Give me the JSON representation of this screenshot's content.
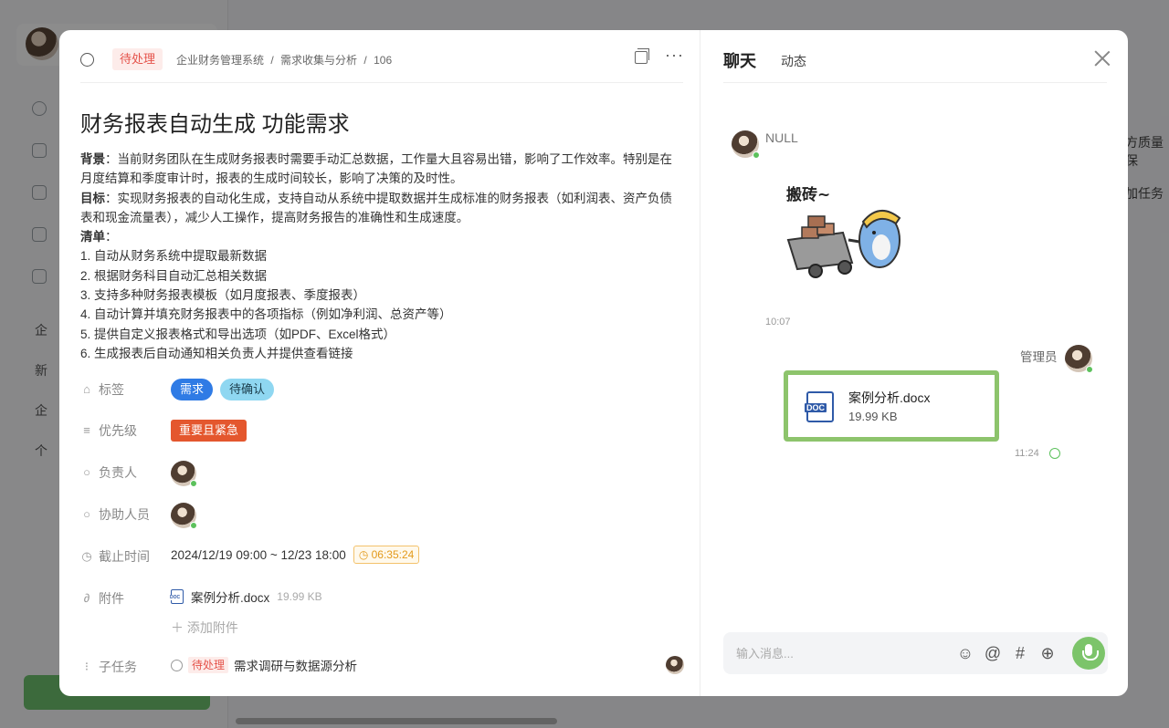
{
  "task": {
    "status": "待处理",
    "breadcrumb": [
      "企业财务管理系统",
      "/",
      "需求收集与分析",
      "/",
      "106"
    ],
    "title": "财务报表自动生成 功能需求",
    "description": {
      "background_label": "背景",
      "background": "：当前财务团队在生成财务报表时需要手动汇总数据，工作量大且容易出错，影响了工作效率。特别是在月度结算和季度审计时，报表的生成时间较长，影响了决策的及时性。",
      "goal_label": "目标",
      "goal": "：实现财务报表的自动化生成，支持自动从系统中提取数据并生成标准的财务报表（如利润表、资产负债表和现金流量表），减少人工操作，提高财务报告的准确性和生成速度。",
      "list_label": "清单",
      "list_colon": "：",
      "items": [
        "1. 自动从财务系统中提取最新数据",
        "2. 根据财务科目自动汇总相关数据",
        "3. 支持多种财务报表模板（如月度报表、季度报表）",
        "4. 自动计算并填充财务报表中的各项指标（例如净利润、总资产等）",
        "5. 提供自定义报表格式和导出选项（如PDF、Excel格式）",
        "6. 生成报表后自动通知相关负责人并提供查看链接"
      ]
    },
    "fields": {
      "tags_label": "标签",
      "tags": [
        "需求",
        "待确认"
      ],
      "priority_label": "优先级",
      "priority": "重要且紧急",
      "owner_label": "负责人",
      "assist_label": "协助人员",
      "deadline_label": "截止时间",
      "deadline": "2024/12/19 09:00 ~ 12/23 18:00",
      "countdown": "06:35:24",
      "attach_label": "附件",
      "attach_name": "案例分析.docx",
      "attach_size": "19.99 KB",
      "add_attach": "添加附件",
      "subtask_label": "子任务",
      "subtask_status": "待处理",
      "subtask_name": "需求调研与数据源分析"
    }
  },
  "chat": {
    "tab_chat": "聊天",
    "tab_activity": "动态",
    "msg1_sender": "NULL",
    "msg1_sticker_text": "搬砖~",
    "msg1_time": "10:07",
    "msg2_sender": "管理员",
    "msg2_file_name": "案例分析.docx",
    "msg2_file_size": "19.99 KB",
    "msg2_time": "11:24",
    "input_placeholder": "输入消息..."
  },
  "background": {
    "tree_items": [
      "企",
      "新",
      "企",
      "个",
      "",
      "",
      "",
      "",
      ""
    ],
    "right_texts": [
      "方质量保",
      "加任务"
    ]
  },
  "colors": {
    "status_red": "#e5534b",
    "tag_blue": "#2f7be5",
    "tag_cyan": "#8fd7f1",
    "priority_orange": "#e4572e",
    "highlight_green": "#8dc46c",
    "mic_green": "#7cc46a"
  }
}
